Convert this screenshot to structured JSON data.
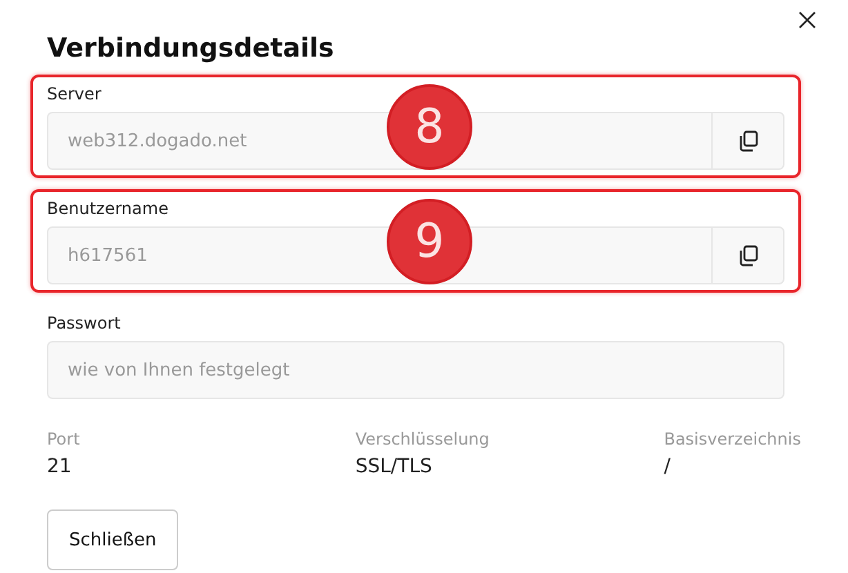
{
  "dialog": {
    "title": "Verbindungsdetails"
  },
  "fields": [
    {
      "label": "Server",
      "value": "web312.dogado.net",
      "copyable": true,
      "highlighted": true,
      "annotation": "8"
    },
    {
      "label": "Benutzername",
      "value": "h617561",
      "copyable": true,
      "highlighted": true,
      "annotation": "9"
    },
    {
      "label": "Passwort",
      "value": "wie von Ihnen festgelegt",
      "copyable": false,
      "highlighted": false
    }
  ],
  "details": [
    {
      "label": "Port",
      "value": "21"
    },
    {
      "label": "Verschlüsselung",
      "value": "SSL/TLS"
    },
    {
      "label": "Basisverzeichnis",
      "value": "/"
    }
  ],
  "buttons": [
    "Schließen"
  ]
}
